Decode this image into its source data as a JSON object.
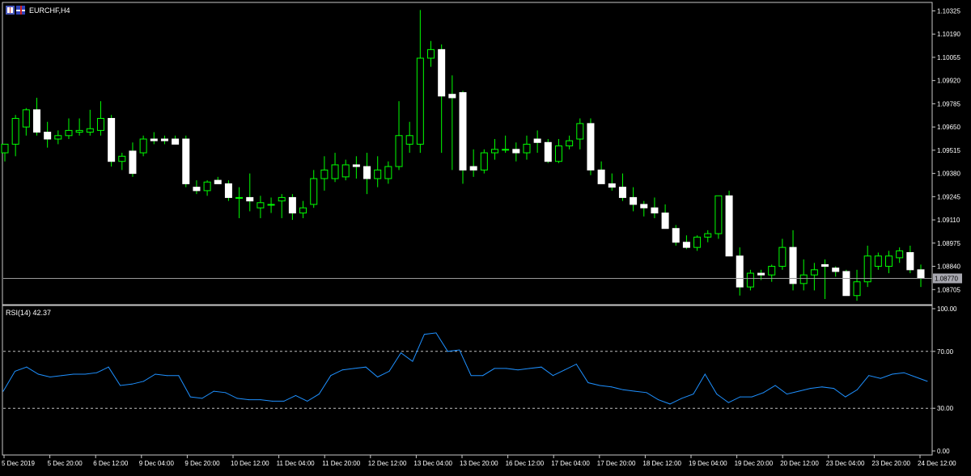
{
  "window": {
    "title": "EURCHF,H4",
    "icons": [
      "chart-window-icon",
      "currency-flags-icon"
    ]
  },
  "colors": {
    "background": "#000000",
    "frame": "#c8c8c8",
    "bull_body": "#000000",
    "bull_outline": "#00ff00",
    "bear_body": "#ffffff",
    "wick": "#00ff00",
    "rsi_line": "#1e90ff",
    "level_line": "#c0c0c0",
    "bid_line": "#9a9a9a",
    "price_label_bg": "#a8a8b0",
    "text": "#ffffff"
  },
  "chart_data": [
    {
      "type": "candlestick",
      "symbol": "EURCHF",
      "timeframe": "H4",
      "ylim": [
        1.0865,
        1.1036
      ],
      "y_ticks": [
        "1.10325",
        "1.10190",
        "1.10055",
        "1.09920",
        "1.09785",
        "1.09650",
        "1.09515",
        "1.09380",
        "1.09245",
        "1.09110",
        "1.08975",
        "1.08840",
        "1.08705"
      ],
      "current_price": "1.08770",
      "x_ticks": [
        "5 Dec 2019",
        "5 Dec 20:00",
        "6 Dec 12:00",
        "9 Dec 04:00",
        "9 Dec 20:00",
        "10 Dec 12:00",
        "11 Dec 04:00",
        "11 Dec 20:00",
        "12 Dec 12:00",
        "13 Dec 04:00",
        "13 Dec 20:00",
        "16 Dec 12:00",
        "17 Dec 04:00",
        "17 Dec 20:00",
        "18 Dec 12:00",
        "19 Dec 04:00",
        "19 Dec 20:00",
        "20 Dec 12:00",
        "23 Dec 04:00",
        "23 Dec 20:00",
        "24 Dec 12:00"
      ],
      "candles": [
        {
          "o": 1.095,
          "h": 1.0955,
          "l": 1.0945,
          "c": 1.0955
        },
        {
          "o": 1.0955,
          "h": 1.0972,
          "l": 1.0948,
          "c": 1.097
        },
        {
          "o": 1.0965,
          "h": 1.0976,
          "l": 1.096,
          "c": 1.0975
        },
        {
          "o": 1.0975,
          "h": 1.0982,
          "l": 1.096,
          "c": 1.0962
        },
        {
          "o": 1.0962,
          "h": 1.0968,
          "l": 1.0953,
          "c": 1.0958
        },
        {
          "o": 1.0958,
          "h": 1.0963,
          "l": 1.0955,
          "c": 1.096
        },
        {
          "o": 1.096,
          "h": 1.097,
          "l": 1.0958,
          "c": 1.0963
        },
        {
          "o": 1.0962,
          "h": 1.097,
          "l": 1.096,
          "c": 1.0963
        },
        {
          "o": 1.0962,
          "h": 1.0975,
          "l": 1.096,
          "c": 1.0964
        },
        {
          "o": 1.0963,
          "h": 1.098,
          "l": 1.096,
          "c": 1.097
        },
        {
          "o": 1.097,
          "h": 1.0972,
          "l": 1.0942,
          "c": 1.0945
        },
        {
          "o": 1.0945,
          "h": 1.095,
          "l": 1.094,
          "c": 1.0948
        },
        {
          "o": 1.0951,
          "h": 1.0956,
          "l": 1.0936,
          "c": 1.0938
        },
        {
          "o": 1.095,
          "h": 1.096,
          "l": 1.0948,
          "c": 1.0958
        },
        {
          "o": 1.0958,
          "h": 1.0962,
          "l": 1.0955,
          "c": 1.0957
        },
        {
          "o": 1.0958,
          "h": 1.096,
          "l": 1.0955,
          "c": 1.0957
        },
        {
          "o": 1.0958,
          "h": 1.096,
          "l": 1.0955,
          "c": 1.0955
        },
        {
          "o": 1.0958,
          "h": 1.096,
          "l": 1.093,
          "c": 1.0932
        },
        {
          "o": 1.093,
          "h": 1.0934,
          "l": 1.0926,
          "c": 1.0928
        },
        {
          "o": 1.0928,
          "h": 1.0934,
          "l": 1.0925,
          "c": 1.0933
        },
        {
          "o": 1.0934,
          "h": 1.0936,
          "l": 1.0932,
          "c": 1.0932
        },
        {
          "o": 1.0932,
          "h": 1.0934,
          "l": 1.0922,
          "c": 1.0924
        },
        {
          "o": 1.0924,
          "h": 1.093,
          "l": 1.0912,
          "c": 1.0924
        },
        {
          "o": 1.0924,
          "h": 1.0938,
          "l": 1.0916,
          "c": 1.0922
        },
        {
          "o": 1.0918,
          "h": 1.0925,
          "l": 1.0912,
          "c": 1.0921
        },
        {
          "o": 1.092,
          "h": 1.0924,
          "l": 1.0915,
          "c": 1.092
        },
        {
          "o": 1.0922,
          "h": 1.0926,
          "l": 1.0912,
          "c": 1.0924
        },
        {
          "o": 1.0924,
          "h": 1.0926,
          "l": 1.0911,
          "c": 1.0915
        },
        {
          "o": 1.0915,
          "h": 1.0922,
          "l": 1.0912,
          "c": 1.0918
        },
        {
          "o": 1.092,
          "h": 1.094,
          "l": 1.0918,
          "c": 1.0935
        },
        {
          "o": 1.0935,
          "h": 1.0948,
          "l": 1.0928,
          "c": 1.094
        },
        {
          "o": 1.0935,
          "h": 1.095,
          "l": 1.0933,
          "c": 1.0943
        },
        {
          "o": 1.0936,
          "h": 1.0946,
          "l": 1.0934,
          "c": 1.0943
        },
        {
          "o": 1.0943,
          "h": 1.0948,
          "l": 1.0935,
          "c": 1.0942
        },
        {
          "o": 1.0942,
          "h": 1.095,
          "l": 1.0926,
          "c": 1.0935
        },
        {
          "o": 1.0935,
          "h": 1.0948,
          "l": 1.093,
          "c": 1.094
        },
        {
          "o": 1.0935,
          "h": 1.0945,
          "l": 1.0932,
          "c": 1.0942
        },
        {
          "o": 1.0942,
          "h": 1.098,
          "l": 1.094,
          "c": 1.096
        },
        {
          "o": 1.0955,
          "h": 1.0968,
          "l": 1.095,
          "c": 1.096
        },
        {
          "o": 1.0955,
          "h": 1.1033,
          "l": 1.095,
          "c": 1.1005
        },
        {
          "o": 1.1005,
          "h": 1.1015,
          "l": 1.1,
          "c": 1.101
        },
        {
          "o": 1.101,
          "h": 1.1013,
          "l": 1.095,
          "c": 1.0983
        },
        {
          "o": 1.0984,
          "h": 1.0995,
          "l": 1.094,
          "c": 1.0982
        },
        {
          "o": 1.0985,
          "h": 1.0986,
          "l": 1.0932,
          "c": 1.094
        },
        {
          "o": 1.0942,
          "h": 1.0952,
          "l": 1.0936,
          "c": 1.094
        },
        {
          "o": 1.094,
          "h": 1.0952,
          "l": 1.0938,
          "c": 1.095
        },
        {
          "o": 1.095,
          "h": 1.0958,
          "l": 1.0946,
          "c": 1.0952
        },
        {
          "o": 1.0952,
          "h": 1.096,
          "l": 1.095,
          "c": 1.0952
        },
        {
          "o": 1.0952,
          "h": 1.0956,
          "l": 1.0945,
          "c": 1.095
        },
        {
          "o": 1.095,
          "h": 1.096,
          "l": 1.0946,
          "c": 1.0955
        },
        {
          "o": 1.0958,
          "h": 1.0963,
          "l": 1.095,
          "c": 1.0956
        },
        {
          "o": 1.0956,
          "h": 1.0958,
          "l": 1.0944,
          "c": 1.0945
        },
        {
          "o": 1.0945,
          "h": 1.0958,
          "l": 1.0944,
          "c": 1.0954
        },
        {
          "o": 1.0954,
          "h": 1.096,
          "l": 1.0952,
          "c": 1.0957
        },
        {
          "o": 1.0958,
          "h": 1.097,
          "l": 1.0952,
          "c": 1.0967
        },
        {
          "o": 1.0967,
          "h": 1.097,
          "l": 1.0937,
          "c": 1.094
        },
        {
          "o": 1.094,
          "h": 1.0945,
          "l": 1.0932,
          "c": 1.0932
        },
        {
          "o": 1.0932,
          "h": 1.0938,
          "l": 1.0928,
          "c": 1.093
        },
        {
          "o": 1.093,
          "h": 1.0938,
          "l": 1.0922,
          "c": 1.0924
        },
        {
          "o": 1.0924,
          "h": 1.093,
          "l": 1.0916,
          "c": 1.092
        },
        {
          "o": 1.092,
          "h": 1.0922,
          "l": 1.0913,
          "c": 1.0918
        },
        {
          "o": 1.0918,
          "h": 1.0924,
          "l": 1.0912,
          "c": 1.0915
        },
        {
          "o": 1.0915,
          "h": 1.092,
          "l": 1.0906,
          "c": 1.0906
        },
        {
          "o": 1.0906,
          "h": 1.0908,
          "l": 1.0896,
          "c": 1.0898
        },
        {
          "o": 1.0898,
          "h": 1.0902,
          "l": 1.0894,
          "c": 1.0895
        },
        {
          "o": 1.0895,
          "h": 1.0902,
          "l": 1.0893,
          "c": 1.0901
        },
        {
          "o": 1.0901,
          "h": 1.0905,
          "l": 1.0898,
          "c": 1.0903
        },
        {
          "o": 1.0903,
          "h": 1.0925,
          "l": 1.09,
          "c": 1.0925
        },
        {
          "o": 1.0925,
          "h": 1.0928,
          "l": 1.089,
          "c": 1.089
        },
        {
          "o": 1.089,
          "h": 1.0895,
          "l": 1.0867,
          "c": 1.0872
        },
        {
          "o": 1.0872,
          "h": 1.0882,
          "l": 1.087,
          "c": 1.088
        },
        {
          "o": 1.088,
          "h": 1.0882,
          "l": 1.0876,
          "c": 1.0879
        },
        {
          "o": 1.0879,
          "h": 1.0885,
          "l": 1.0875,
          "c": 1.0884
        },
        {
          "o": 1.0884,
          "h": 1.09,
          "l": 1.0882,
          "c": 1.0895
        },
        {
          "o": 1.0895,
          "h": 1.0905,
          "l": 1.087,
          "c": 1.0874
        },
        {
          "o": 1.0874,
          "h": 1.0888,
          "l": 1.087,
          "c": 1.0879
        },
        {
          "o": 1.0879,
          "h": 1.0886,
          "l": 1.087,
          "c": 1.0882
        },
        {
          "o": 1.0885,
          "h": 1.0888,
          "l": 1.0865,
          "c": 1.0884
        },
        {
          "o": 1.0883,
          "h": 1.0884,
          "l": 1.0878,
          "c": 1.0881
        },
        {
          "o": 1.0881,
          "h": 1.0882,
          "l": 1.0867,
          "c": 1.0867
        },
        {
          "o": 1.0867,
          "h": 1.0882,
          "l": 1.0864,
          "c": 1.0875
        },
        {
          "o": 1.0875,
          "h": 1.0896,
          "l": 1.0872,
          "c": 1.089
        },
        {
          "o": 1.0884,
          "h": 1.0892,
          "l": 1.0882,
          "c": 1.089
        },
        {
          "o": 1.0884,
          "h": 1.0893,
          "l": 1.088,
          "c": 1.089
        },
        {
          "o": 1.0889,
          "h": 1.0895,
          "l": 1.0886,
          "c": 1.0893
        },
        {
          "o": 1.0892,
          "h": 1.0896,
          "l": 1.088,
          "c": 1.0882
        },
        {
          "o": 1.0882,
          "h": 1.0885,
          "l": 1.0872,
          "c": 1.0877
        }
      ]
    },
    {
      "type": "line",
      "indicator": "RSI",
      "label": "RSI(14) 42.37",
      "ylim": [
        0,
        100
      ],
      "y_ticks": [
        "100.00",
        "70.00",
        "30.00",
        "0.00"
      ],
      "levels": [
        70,
        30
      ],
      "values": [
        42,
        56,
        59,
        54,
        52,
        53,
        54,
        54,
        55,
        59,
        46,
        47,
        49,
        54,
        53,
        53,
        38,
        37,
        42,
        41,
        37,
        36,
        36,
        35,
        35,
        39,
        35,
        40,
        53,
        57,
        58,
        59,
        52,
        56,
        69,
        63,
        82,
        83,
        70,
        71,
        53,
        53,
        58,
        58,
        57,
        58,
        59,
        53,
        57,
        61,
        48,
        46,
        45,
        43,
        42,
        41,
        36,
        33,
        37,
        40,
        54,
        40,
        34,
        38,
        38,
        41,
        46,
        40,
        42,
        44,
        45,
        44,
        38,
        43,
        53,
        51,
        54,
        55,
        52,
        49
      ]
    }
  ]
}
